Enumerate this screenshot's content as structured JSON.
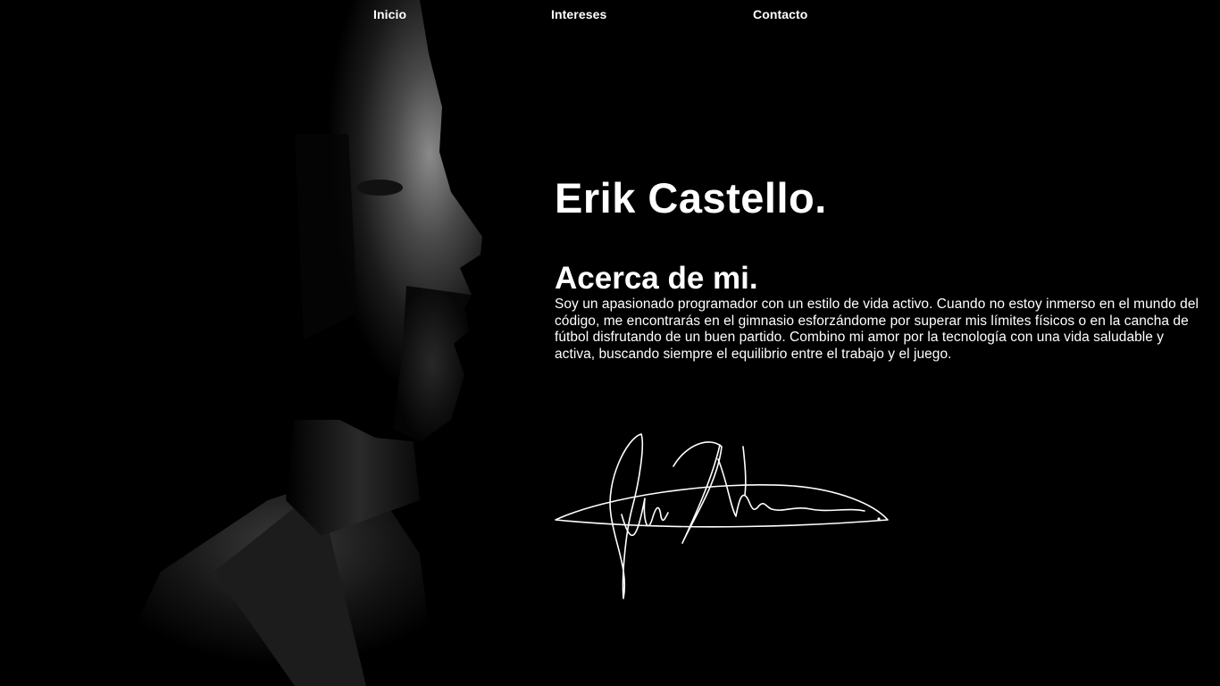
{
  "nav": {
    "items": [
      {
        "label": "Inicio"
      },
      {
        "label": "Intereses"
      },
      {
        "label": "Contacto"
      }
    ]
  },
  "hero": {
    "name": "Erik Castello.",
    "about_heading": "Acerca de mi.",
    "about_text": "Soy un apasionado programador con un estilo de vida activo. Cuando no estoy inmerso en el mundo del código, me encontrarás en el gimnasio esforzándome por superar mis límites físicos o en la cancha de fútbol disfrutando de un buen partido. Combino mi amor por la tecnología con una vida saludable y activa, buscando siempre el equilibrio entre el trabajo y el juego."
  },
  "colors": {
    "background": "#000000",
    "text": "#ffffff"
  }
}
